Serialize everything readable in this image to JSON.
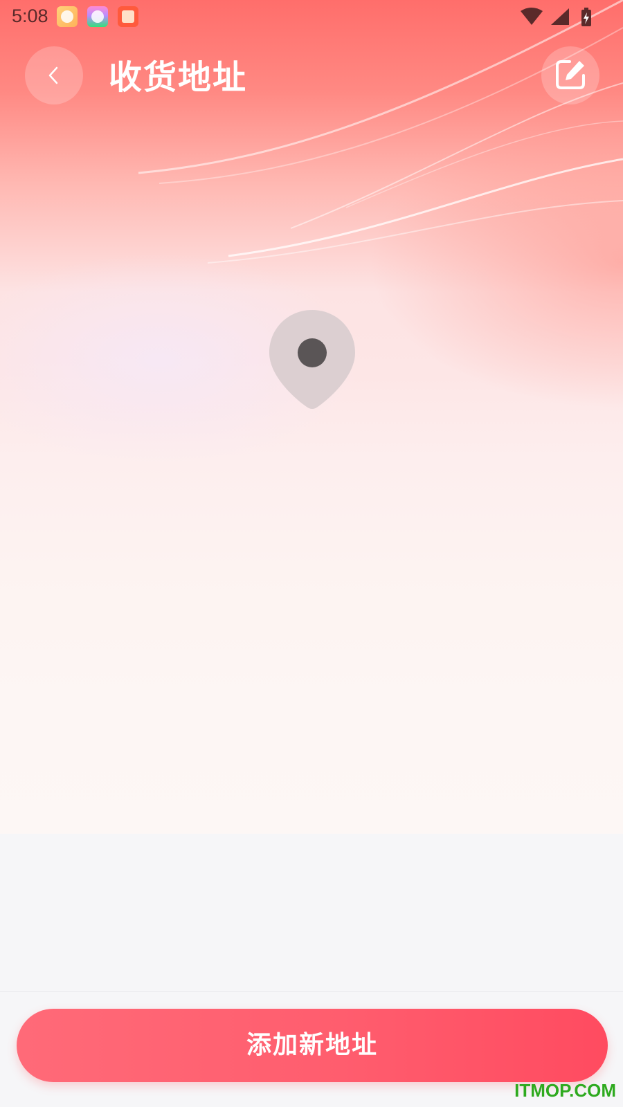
{
  "status_bar": {
    "time": "5:08",
    "notification_icons": [
      "cat-app-icon",
      "gallery-app-icon",
      "book-app-icon"
    ],
    "system_icons": [
      "wifi-icon",
      "signal-icon",
      "battery-charging-icon"
    ]
  },
  "header": {
    "title": "收货地址",
    "back_icon": "chevron-left-icon",
    "edit_icon": "edit-icon"
  },
  "empty_state": {
    "icon": "location-pin-icon"
  },
  "footer": {
    "add_button_label": "添加新地址"
  },
  "watermark": "ITMOP.COM",
  "colors": {
    "accent": "#ff5d6e",
    "header_bg": "#ff6e6b",
    "page_bg": "#f6f6f8",
    "pin_fill": "#dccfd1",
    "pin_dot": "#5a5556",
    "watermark": "#2eaa1f"
  }
}
